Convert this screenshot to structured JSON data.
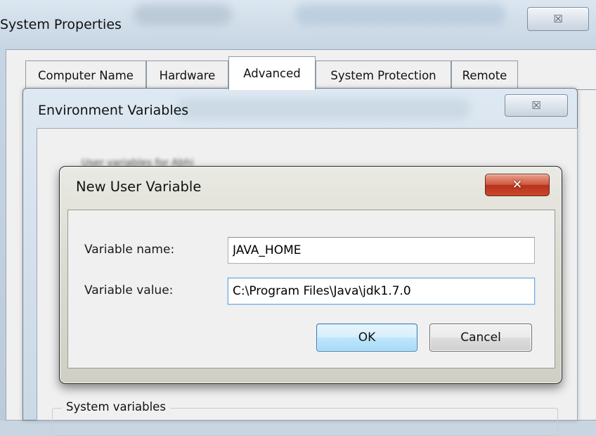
{
  "system_properties": {
    "title": "System Properties",
    "close_glyph": "☒",
    "tabs": [
      {
        "label": "Computer Name",
        "active": false
      },
      {
        "label": "Hardware",
        "active": false
      },
      {
        "label": "Advanced",
        "active": true
      },
      {
        "label": "System Protection",
        "active": false
      },
      {
        "label": "Remote",
        "active": false
      }
    ]
  },
  "environment_variables": {
    "title": "Environment Variables",
    "close_glyph": "☒",
    "user_variables_label": "User variables for Abhi",
    "system_variables_label": "System variables"
  },
  "new_user_variable": {
    "title": "New User Variable",
    "close_glyph": "✕",
    "name_label": "Variable name:",
    "name_value": "JAVA_HOME",
    "value_label": "Variable value:",
    "value_value": "C:\\Program Files\\Java\\jdk1.7.0",
    "ok_label": "OK",
    "cancel_label": "Cancel"
  },
  "colors": {
    "ok_button_accent": "#a7d9f5",
    "close_button_red": "#c9492c",
    "field_focus_border": "#6fa8dc"
  }
}
